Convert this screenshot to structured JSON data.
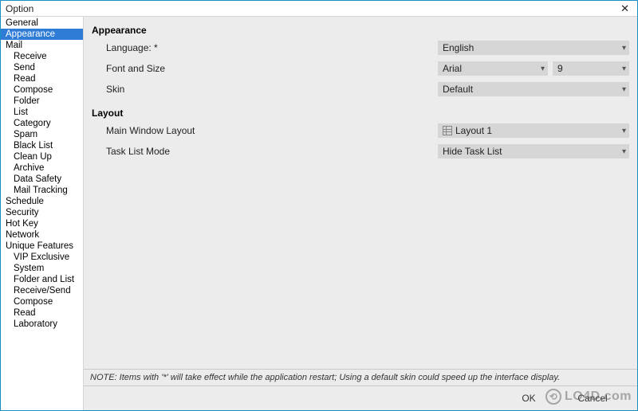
{
  "window": {
    "title": "Option"
  },
  "sidebar": {
    "items": [
      {
        "label": "General",
        "child": false,
        "selected": false
      },
      {
        "label": "Appearance",
        "child": false,
        "selected": true
      },
      {
        "label": "Mail",
        "child": false,
        "selected": false
      },
      {
        "label": "Receive",
        "child": true,
        "selected": false
      },
      {
        "label": "Send",
        "child": true,
        "selected": false
      },
      {
        "label": "Read",
        "child": true,
        "selected": false
      },
      {
        "label": "Compose",
        "child": true,
        "selected": false
      },
      {
        "label": "Folder",
        "child": true,
        "selected": false
      },
      {
        "label": "List",
        "child": true,
        "selected": false
      },
      {
        "label": "Category",
        "child": true,
        "selected": false
      },
      {
        "label": "Spam",
        "child": true,
        "selected": false
      },
      {
        "label": "Black List",
        "child": true,
        "selected": false
      },
      {
        "label": "Clean Up",
        "child": true,
        "selected": false
      },
      {
        "label": "Archive",
        "child": true,
        "selected": false
      },
      {
        "label": "Data Safety",
        "child": true,
        "selected": false
      },
      {
        "label": "Mail Tracking",
        "child": true,
        "selected": false
      },
      {
        "label": "Schedule",
        "child": false,
        "selected": false
      },
      {
        "label": "Security",
        "child": false,
        "selected": false
      },
      {
        "label": "Hot Key",
        "child": false,
        "selected": false
      },
      {
        "label": "Network",
        "child": false,
        "selected": false
      },
      {
        "label": "Unique Features",
        "child": false,
        "selected": false
      },
      {
        "label": "VIP Exclusive",
        "child": true,
        "selected": false
      },
      {
        "label": "System",
        "child": true,
        "selected": false
      },
      {
        "label": "Folder and List",
        "child": true,
        "selected": false
      },
      {
        "label": "Receive/Send",
        "child": true,
        "selected": false
      },
      {
        "label": "Compose",
        "child": true,
        "selected": false
      },
      {
        "label": "Read",
        "child": true,
        "selected": false
      },
      {
        "label": "Laboratory",
        "child": true,
        "selected": false
      }
    ]
  },
  "sections": {
    "appearance": {
      "heading": "Appearance",
      "language": {
        "label": "Language: *",
        "value": "English"
      },
      "font": {
        "label": "Font and Size",
        "value": "Arial",
        "size": "9"
      },
      "skin": {
        "label": "Skin",
        "value": "Default"
      }
    },
    "layout": {
      "heading": "Layout",
      "mainWindow": {
        "label": "Main Window Layout",
        "value": "Layout 1"
      },
      "taskList": {
        "label": "Task List Mode",
        "value": "Hide Task List"
      }
    }
  },
  "note": "NOTE: Items with '*' will take effect while the application restart; Using a default skin could speed up the interface display.",
  "buttons": {
    "ok": "OK",
    "cancel": "Cancel"
  },
  "watermark": "LO4D.com"
}
